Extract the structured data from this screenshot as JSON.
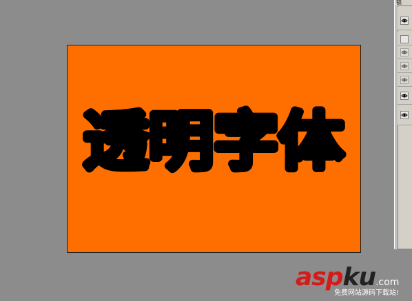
{
  "document": {
    "headline": "透明字体",
    "background_color": "#ff6f00",
    "text_color": "#000000"
  },
  "layers_panel": {
    "tab_label": "锁",
    "rows": [
      {
        "visible": true,
        "style": "normal"
      },
      {
        "visible": false,
        "style": "empty"
      },
      {
        "visible": true,
        "style": "faded"
      },
      {
        "visible": true,
        "style": "faded"
      },
      {
        "visible": true,
        "style": "faded"
      },
      {
        "visible": true,
        "style": "normal"
      },
      {
        "visible": true,
        "style": "normal"
      }
    ]
  },
  "watermark": {
    "logo_part1": "asp",
    "logo_part2": "ku",
    "logo_suffix": ".com",
    "tagline": "免费网站源码下载站!",
    "brand_color": "#d61a1a"
  }
}
